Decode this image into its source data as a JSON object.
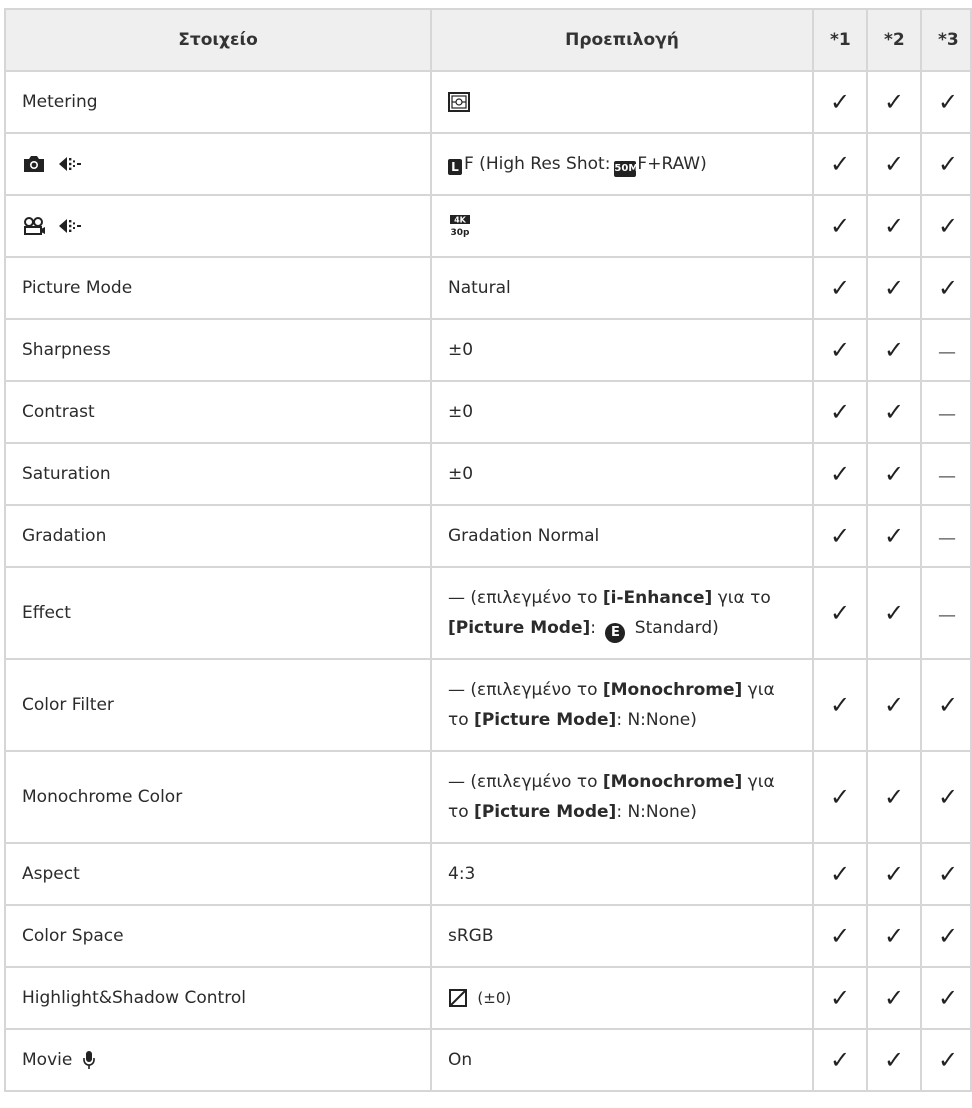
{
  "table": {
    "headers": [
      "Στοιχείο",
      "Προεπιλογή",
      "*1",
      "*2",
      "*3"
    ],
    "check_glyph": "✓",
    "dash_glyph": "—",
    "rows": [
      {
        "item": "Metering",
        "default": "",
        "marks": [
          "✓",
          "✓",
          "✓"
        ]
      },
      {
        "item": "",
        "default": "F (High Res Shot:",
        "default2": "F+RAW)",
        "badge_L": "L",
        "badge_50": "50M",
        "marks": [
          "✓",
          "✓",
          "✓"
        ]
      },
      {
        "item": "",
        "default": "",
        "marks": [
          "✓",
          "✓",
          "✓"
        ]
      },
      {
        "item": "Picture Mode",
        "default": "Natural",
        "marks": [
          "✓",
          "✓",
          "✓"
        ]
      },
      {
        "item": "Sharpness",
        "default": "±0",
        "marks": [
          "✓",
          "✓",
          "—"
        ]
      },
      {
        "item": "Contrast",
        "default": "±0",
        "marks": [
          "✓",
          "✓",
          "—"
        ]
      },
      {
        "item": "Saturation",
        "default": "±0",
        "marks": [
          "✓",
          "✓",
          "—"
        ]
      },
      {
        "item": "Gradation",
        "default": "Gradation Normal",
        "marks": [
          "✓",
          "✓",
          "—"
        ]
      },
      {
        "item": "Effect",
        "default_a": "— (επιλεγμένο το ",
        "default_b": "[i-Enhance]",
        "default_c": " για το ",
        "default_d": "[Picture Mode]",
        "default_e": ": ",
        "default_badge": "E",
        "default_f": " Standard)",
        "marks": [
          "✓",
          "✓",
          "—"
        ]
      },
      {
        "item": "Color Filter",
        "default_a": "— (επιλεγμένο το ",
        "default_b": "[Monochrome]",
        "default_c": " για το ",
        "default_d": "[Picture Mode]",
        "default_e": ": N:None)",
        "marks": [
          "✓",
          "✓",
          "✓"
        ]
      },
      {
        "item": "Monochrome Color",
        "default_a": "— (επιλεγμένο το ",
        "default_b": "[Monochrome]",
        "default_c": " για το ",
        "default_d": "[Picture Mode]",
        "default_e": ": N:None)",
        "marks": [
          "✓",
          "✓",
          "✓"
        ]
      },
      {
        "item": "Aspect",
        "default": "4:3",
        "marks": [
          "✓",
          "✓",
          "✓"
        ]
      },
      {
        "item": "Color Space",
        "default": "sRGB",
        "marks": [
          "✓",
          "✓",
          "✓"
        ]
      },
      {
        "item": "Highlight&Shadow Control",
        "default": "(±0)",
        "marks": [
          "✓",
          "✓",
          "✓"
        ]
      },
      {
        "item": "Movie",
        "default": "On",
        "marks": [
          "✓",
          "✓",
          "✓"
        ]
      }
    ]
  }
}
